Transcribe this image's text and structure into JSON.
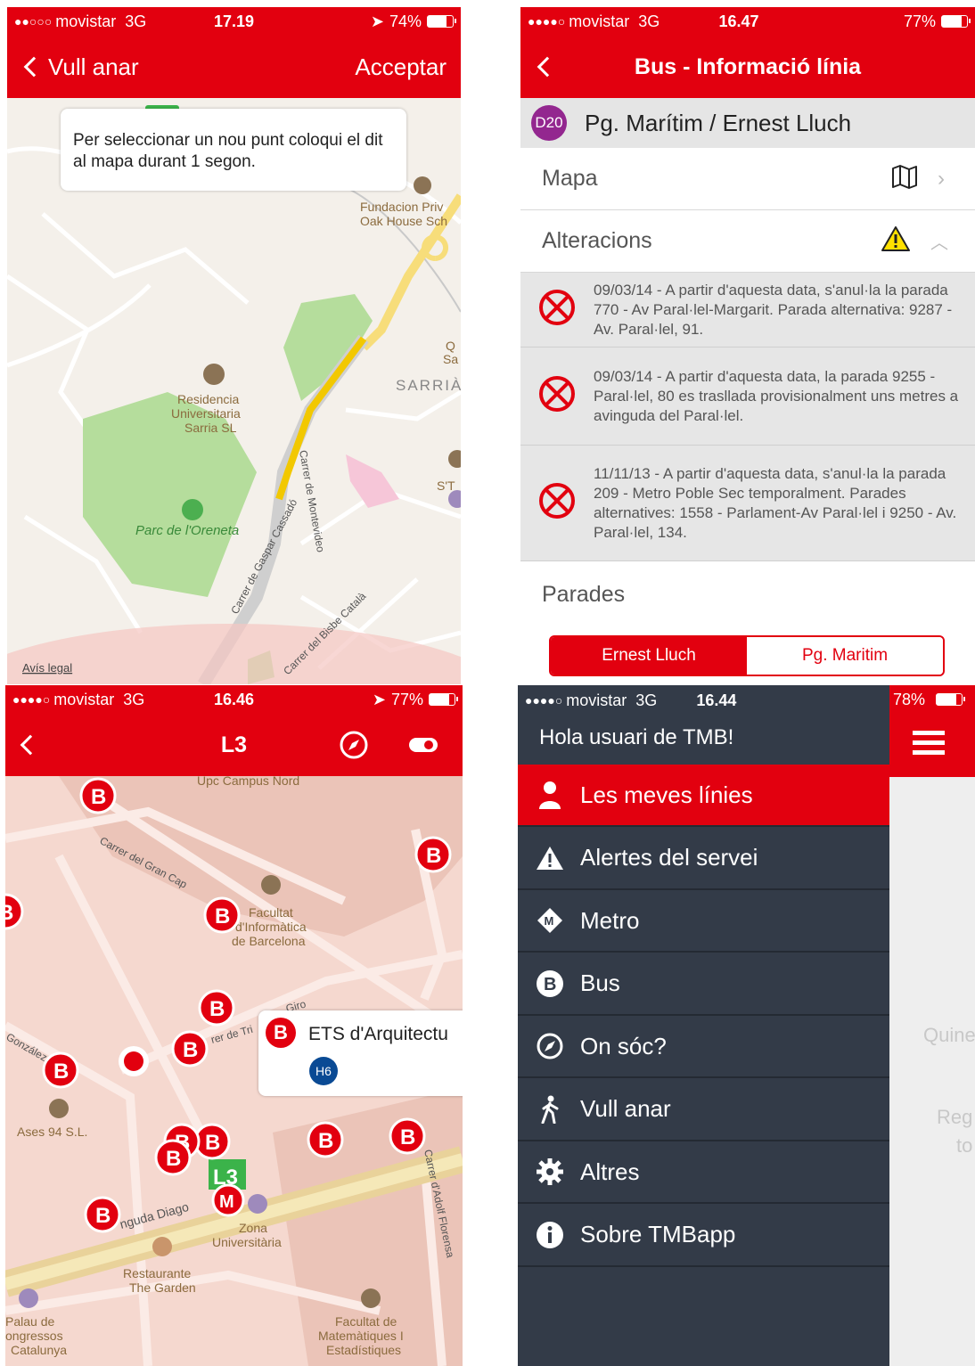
{
  "top_left": {
    "status": {
      "signal": "●●○○○",
      "carrier": "movistar",
      "network": "3G",
      "time": "17.19",
      "battery": "74%"
    },
    "nav": {
      "back_label": "Vull anar",
      "accept_label": "Acceptar"
    },
    "tooltip": "Per seleccionar un nou punt coloqui el dit al mapa durant 1 segon.",
    "map_labels": {
      "fundacion_1": "Fundacion Priv",
      "fundacion_2": "Oak House Sch",
      "sarria": "SARRIÀ",
      "residencia_1": "Residencia",
      "residencia_2": "Universitaria",
      "residencia_3": "Sarria SL",
      "parc": "Parc de l'Oreneta",
      "street_gaspar": "Carrer de Gaspar Cassadó",
      "street_montevideo": "Carrer de Montevideo",
      "street_bisbe": "Carrer del Bisbe Català",
      "q1": "Q",
      "q2": "Sa",
      "st": "S'T",
      "legal": "Avís legal"
    }
  },
  "top_right": {
    "status": {
      "signal": "●●●●○",
      "carrier": "movistar",
      "network": "3G",
      "time": "16.47",
      "battery": "77%"
    },
    "nav": {
      "title": "Bus - Informació línia"
    },
    "line": {
      "code": "D20",
      "name": "Pg. Marítim / Ernest Lluch"
    },
    "rows": {
      "map": "Mapa",
      "alterations": "Alteracions"
    },
    "alterations": [
      "09/03/14 - A partir d'aquesta data, s'anul·la la parada 770 - Av Paral·lel-Margarit. Parada alternativa: 9287 - Av. Paral·lel, 91.",
      "09/03/14 - A partir d'aquesta data,  la parada 9255 - Paral·lel, 80 es trasllada provisionalment uns metres a avinguda del Paral·lel.",
      "11/11/13 - A partir d'aquesta data, s'anul·la la parada 209 - Metro Poble Sec temporalment. Parades alternatives: 1558 - Parlament-Av Paral·lel i 9250 - Av. Paral·lel, 134."
    ],
    "stops_title": "Parades",
    "segments": [
      "Ernest Lluch",
      "Pg. Maritim"
    ]
  },
  "bottom_left": {
    "status": {
      "signal": "●●●●○",
      "carrier": "movistar",
      "network": "3G",
      "time": "16.46",
      "battery": "77%"
    },
    "nav": {
      "title": "L3"
    },
    "callout": {
      "title": "ETS d'Arquitectu",
      "line": "H6"
    },
    "map_labels": {
      "upc": "Upc Campus Nord",
      "gran_cap": "Carrer del Gran Cap",
      "facultat_inf_1": "Facultat",
      "facultat_inf_2": "d'Informàtica",
      "facultat_inf_3": "de Barcelona",
      "tri": "rer de Tri",
      "giro": "Giro",
      "gonzalez": "González",
      "ases": "Ases 94 S.L.",
      "diagonal": "nguda Diago",
      "zona_1": "Zona",
      "zona_2": "Universitària",
      "rest_1": "Restaurante",
      "rest_2": "The Garden",
      "palau_1": "Palau de",
      "palau_2": "ongressos",
      "palau_3": "Catalunya",
      "mat_1": "Facultat de",
      "mat_2": "Matemàtiques I",
      "mat_3": "Estadístiques",
      "adolf": "Carrer d'Adolf Florensa",
      "l3": "L3",
      "m": "M",
      "b": "B"
    }
  },
  "bottom_right": {
    "status": {
      "signal": "●●●●○",
      "carrier": "movistar",
      "network": "3G",
      "time": "16.44",
      "battery": "78%"
    },
    "greeting": "Hola usuari de TMB!",
    "menu": [
      {
        "label": "Les meves línies",
        "icon": "person-icon"
      },
      {
        "label": "Alertes del servei",
        "icon": "warning-icon"
      },
      {
        "label": "Metro",
        "icon": "metro-icon"
      },
      {
        "label": "Bus",
        "icon": "bus-icon"
      },
      {
        "label": "On sóc?",
        "icon": "compass-icon"
      },
      {
        "label": "Vull anar",
        "icon": "walk-icon"
      },
      {
        "label": "Altres",
        "icon": "gear-icon"
      },
      {
        "label": "Sobre TMBapp",
        "icon": "info-icon"
      }
    ],
    "side_text_1": "Quine",
    "side_text_2": "Reg",
    "side_text_3": "to"
  },
  "colors": {
    "tmb_red": "#e2000f",
    "menu_bg": "#333b48",
    "d20_purple": "#93278f",
    "park_green": "#b5dd9c",
    "map_bg": "#f4f0ea"
  }
}
